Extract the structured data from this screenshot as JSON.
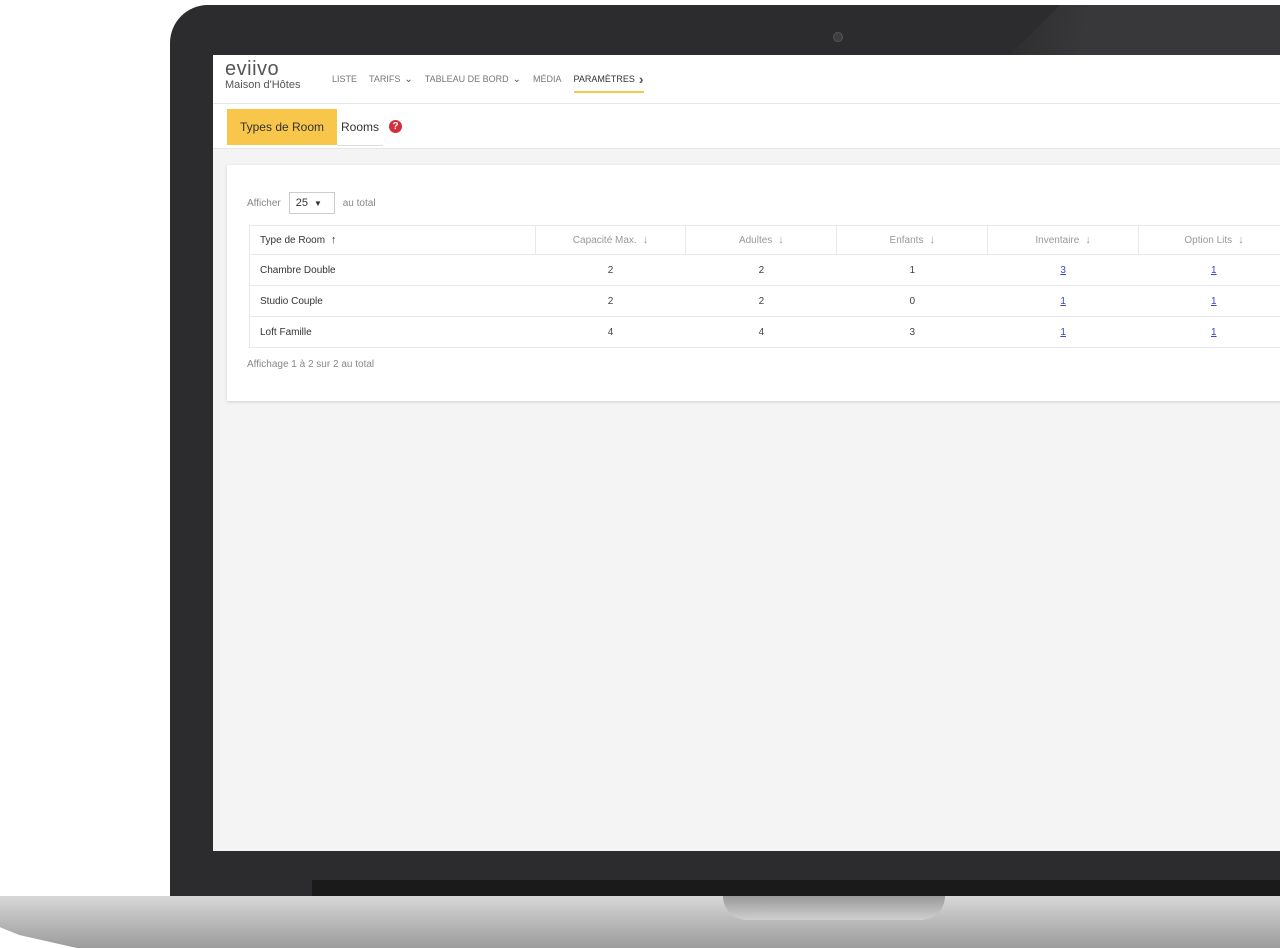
{
  "brand": {
    "logo": "eviivo",
    "subtitle": "Maison d'Hôtes"
  },
  "nav": {
    "items": [
      {
        "label": "LISTE",
        "chevron": ""
      },
      {
        "label": "TARIFS",
        "chevron": "⌄"
      },
      {
        "label": "TABLEAU DE BORD",
        "chevron": "⌄"
      },
      {
        "label": "MÉDIA",
        "chevron": ""
      },
      {
        "label": "PARAMÈTRES",
        "chevron": "›"
      }
    ],
    "active_index": 4,
    "accent_color": "#f7c64a"
  },
  "subtabs": {
    "room_types": "Types de Room",
    "rooms": "Rooms",
    "help_glyph": "?"
  },
  "table_controls": {
    "show_label": "Afficher",
    "page_size": "25",
    "total_label": "au total"
  },
  "table": {
    "columns": [
      {
        "label": "Type de Room",
        "sort": "↑"
      },
      {
        "label": "Capacité Max.",
        "sort": "↓"
      },
      {
        "label": "Adultes",
        "sort": "↓"
      },
      {
        "label": "Enfants",
        "sort": "↓"
      },
      {
        "label": "Inventaire",
        "sort": "↓"
      },
      {
        "label": "Option Lits",
        "sort": "↓"
      }
    ],
    "rows": [
      {
        "type": "Chambre Double",
        "capacity": "2",
        "adults": "2",
        "children": "1",
        "inventory": "3",
        "bed_options": "1"
      },
      {
        "type": "Studio Couple",
        "capacity": "2",
        "adults": "2",
        "children": "0",
        "inventory": "1",
        "bed_options": "1"
      },
      {
        "type": "Loft Famille",
        "capacity": "4",
        "adults": "4",
        "children": "3",
        "inventory": "1",
        "bed_options": "1"
      }
    ]
  },
  "footer": {
    "summary": "Affichage 1 à 2 sur 2 au total"
  }
}
